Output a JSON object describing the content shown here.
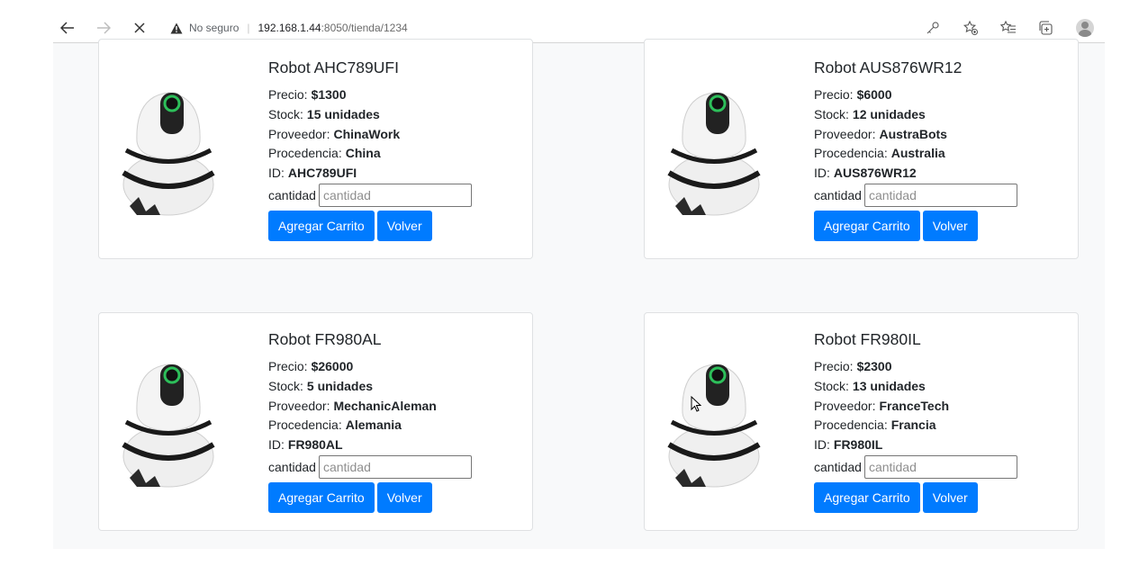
{
  "browser": {
    "security_label": "No seguro",
    "host": "192.168.1.44",
    "path": ":8050/tienda/1234"
  },
  "products": [
    {
      "title": "Robot AHC789UFI",
      "price_label": "Precio:",
      "price": "$1300",
      "stock_label": "Stock:",
      "stock": "15 unidades",
      "supplier_label": "Proveedor:",
      "supplier": "ChinaWork",
      "origin_label": "Procedencia:",
      "origin": "China",
      "id_label": "ID:",
      "id": "AHC789UFI",
      "qty_label": "cantidad",
      "qty_placeholder": "cantidad",
      "add_label": "Agregar Carrito",
      "back_label": "Volver"
    },
    {
      "title": "Robot AUS876WR12",
      "price_label": "Precio:",
      "price": "$6000",
      "stock_label": "Stock:",
      "stock": "12 unidades",
      "supplier_label": "Proveedor:",
      "supplier": "AustraBots",
      "origin_label": "Procedencia:",
      "origin": "Australia",
      "id_label": "ID:",
      "id": "AUS876WR12",
      "qty_label": "cantidad",
      "qty_placeholder": "cantidad",
      "add_label": "Agregar Carrito",
      "back_label": "Volver"
    },
    {
      "title": "Robot FR980AL",
      "price_label": "Precio:",
      "price": "$26000",
      "stock_label": "Stock:",
      "stock": "5 unidades",
      "supplier_label": "Proveedor:",
      "supplier": "MechanicAleman",
      "origin_label": "Procedencia:",
      "origin": "Alemania",
      "id_label": "ID:",
      "id": "FR980AL",
      "qty_label": "cantidad",
      "qty_placeholder": "cantidad",
      "add_label": "Agregar Carrito",
      "back_label": "Volver"
    },
    {
      "title": "Robot FR980IL",
      "price_label": "Precio:",
      "price": "$2300",
      "stock_label": "Stock:",
      "stock": "13 unidades",
      "supplier_label": "Proveedor:",
      "supplier": "FranceTech",
      "origin_label": "Procedencia:",
      "origin": "Francia",
      "id_label": "ID:",
      "id": "FR980IL",
      "qty_label": "cantidad",
      "qty_placeholder": "cantidad",
      "add_label": "Agregar Carrito",
      "back_label": "Volver"
    }
  ]
}
